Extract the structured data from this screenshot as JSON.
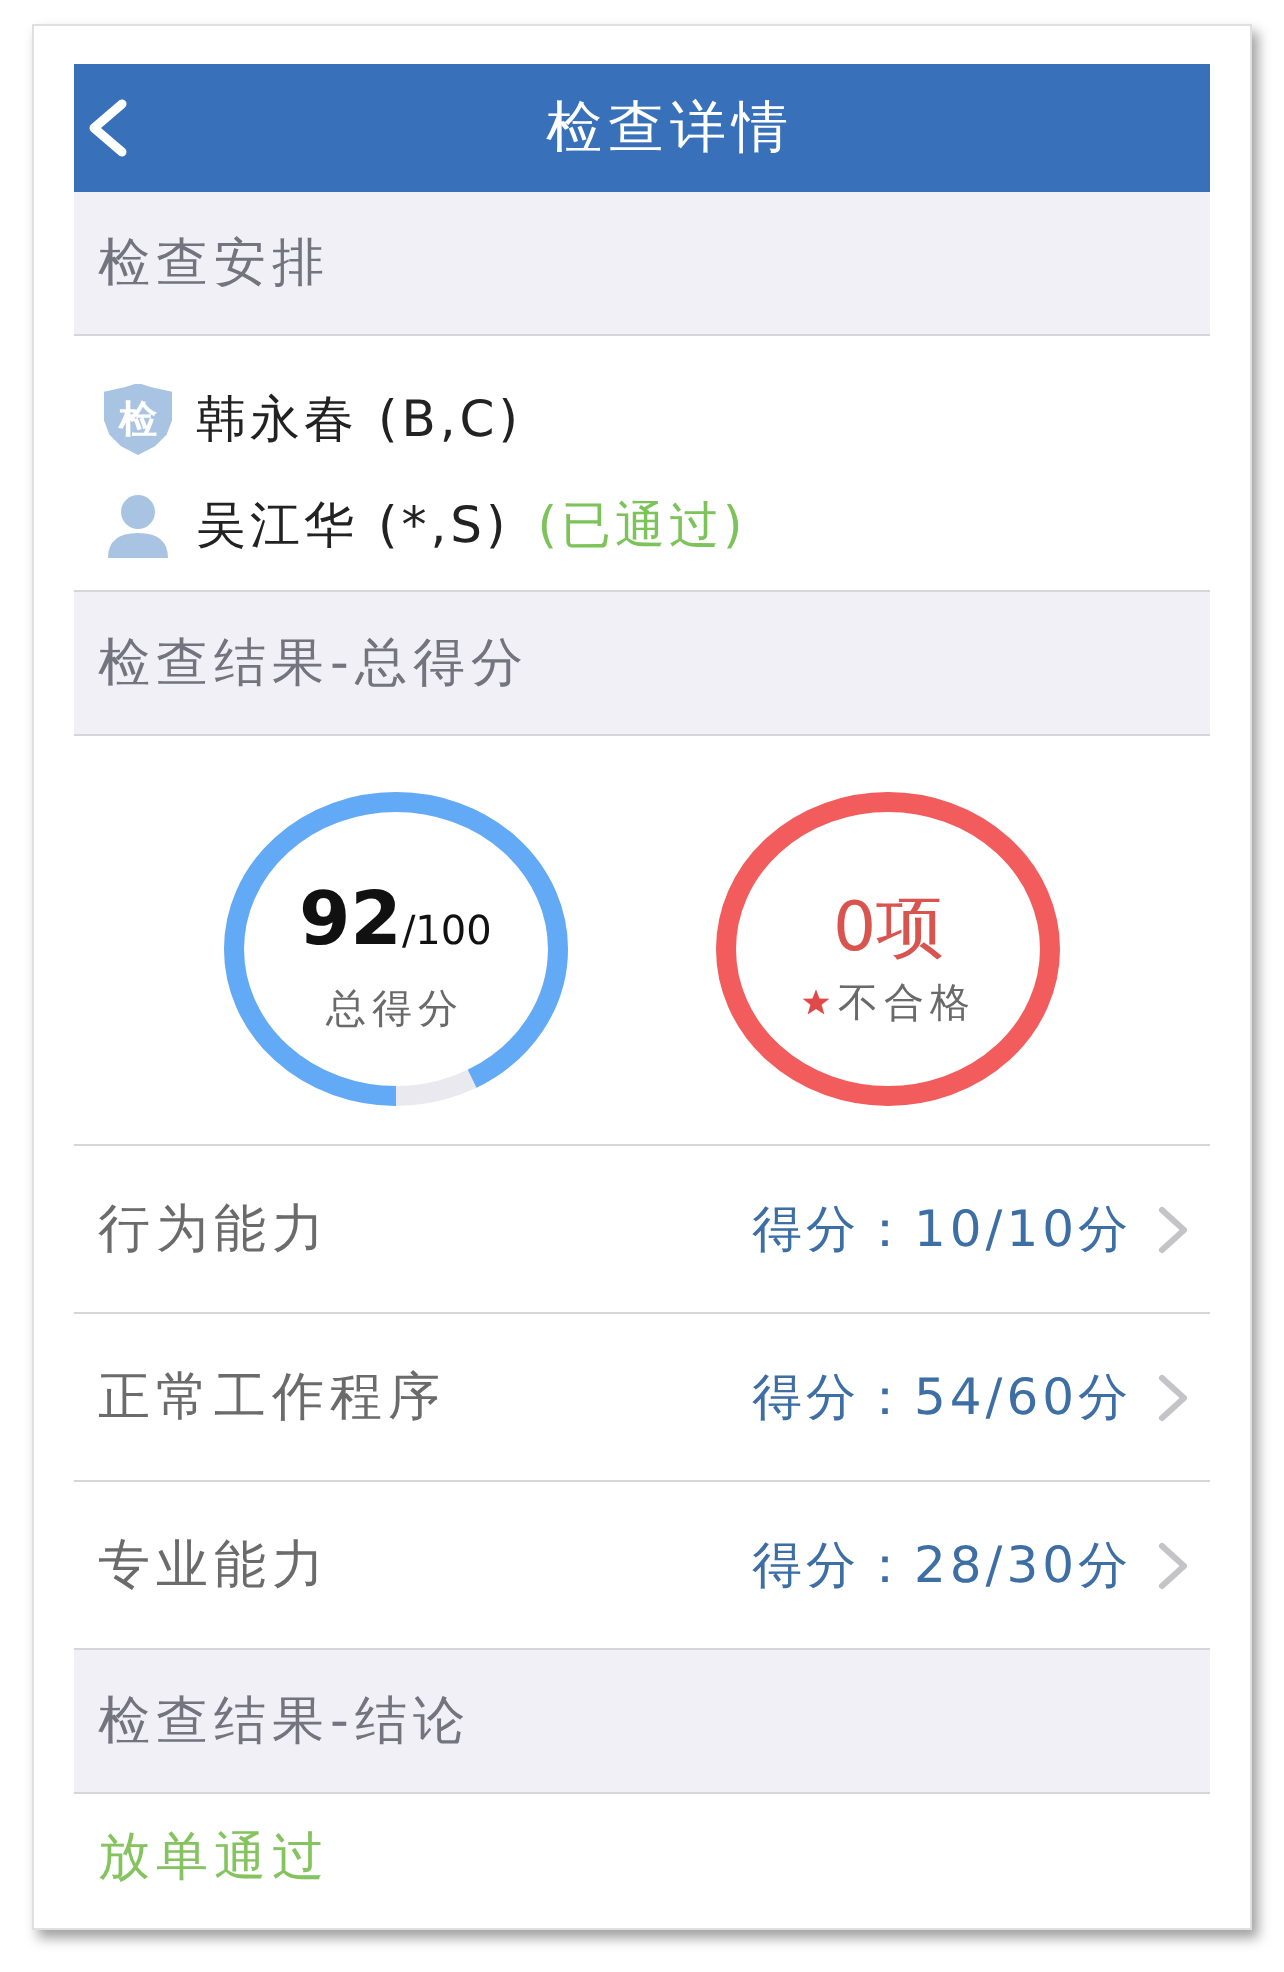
{
  "header": {
    "title": "检查详情"
  },
  "arrangement": {
    "heading": "检查安排",
    "people": [
      {
        "kind": "examiner",
        "badge": "检",
        "name": "韩永春 (B,C)"
      },
      {
        "kind": "examinee",
        "name": "吴江华 (*,S)",
        "status": "(已通过)"
      }
    ]
  },
  "total": {
    "heading": "检查结果-总得分",
    "score": {
      "value": "92",
      "max": "/100",
      "label": "总得分",
      "level": 0.92
    },
    "failures": {
      "count": "0项",
      "label": "不合格"
    }
  },
  "categories": [
    {
      "name": "行为能力",
      "score": "得分：10/10分"
    },
    {
      "name": "正常工作程序",
      "score": "得分：54/60分"
    },
    {
      "name": "专业能力",
      "score": "得分：28/30分"
    }
  ],
  "conclusion": {
    "heading": "检查结果-结论",
    "result": "放单通过"
  }
}
